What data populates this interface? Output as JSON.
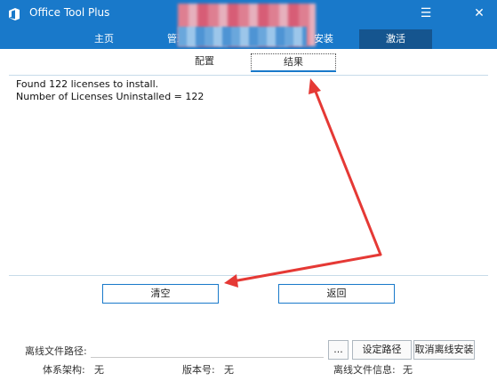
{
  "window": {
    "title": "Office Tool Plus",
    "minimize_glyph": "☰",
    "close_glyph": "✕"
  },
  "tabs": [
    {
      "label": "主页",
      "active": false
    },
    {
      "label": "管理",
      "active": false
    },
    {
      "label": "安装",
      "active": false
    },
    {
      "label": "激活",
      "active": true
    }
  ],
  "subtabs": [
    {
      "label": "配置",
      "active": false
    },
    {
      "label": "结果",
      "active": true
    }
  ],
  "result": {
    "lines": "Found 122 licenses to install.\nNumber of Licenses Uninstalled = 122"
  },
  "actions": {
    "clear_label": "清空",
    "back_label": "返回"
  },
  "offline": {
    "path_label": "离线文件路径:",
    "path_value": "",
    "browse_label": "...",
    "set_path_label": "设定路径",
    "cancel_offline_label": "取消离线安装"
  },
  "info": {
    "arch_label": "体系架构:",
    "arch_value": "无",
    "version_label": "版本号:",
    "version_value": "无",
    "offline_info_label": "离线文件信息:",
    "offline_info_value": "无"
  },
  "colors": {
    "accent": "#1979ca",
    "active_tab": "#15558f",
    "annotation_arrow": "#e53935"
  },
  "icons": [
    "app-logo-icon",
    "menu-icon",
    "close-icon"
  ]
}
